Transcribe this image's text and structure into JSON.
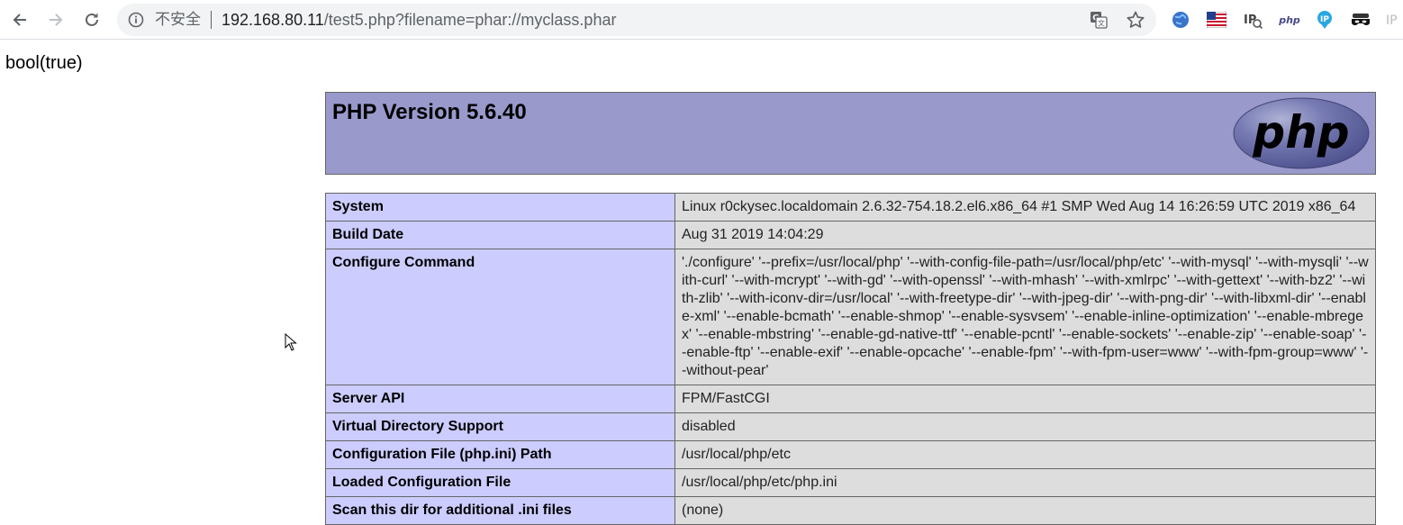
{
  "browser": {
    "security_label": "不安全",
    "url_host": "192.168.80.11",
    "url_path": "/test5.php?filename=phar://myclass.phar",
    "extensions": [
      "globe-icon",
      "flag-icon",
      "ip-icon",
      "php-icon",
      "ip-pin-icon",
      "mask-icon",
      "ip-icon"
    ],
    "ext_php_label": "php",
    "ext_ip_label": "IP",
    "ext_ip_label_2": "IP"
  },
  "page": {
    "output": "bool(true)"
  },
  "phpinfo": {
    "title": "PHP Version 5.6.40",
    "logo_text": "php",
    "rows": [
      {
        "label": "System",
        "value": "Linux r0ckysec.localdomain 2.6.32-754.18.2.el6.x86_64 #1 SMP Wed Aug 14 16:26:59 UTC 2019 x86_64"
      },
      {
        "label": "Build Date",
        "value": "Aug 31 2019 14:04:29"
      },
      {
        "label": "Configure Command",
        "value": "'./configure' '--prefix=/usr/local/php' '--with-config-file-path=/usr/local/php/etc' '--with-mysql' '--with-mysqli' '--with-curl' '--with-mcrypt' '--with-gd' '--with-openssl' '--with-mhash' '--with-xmlrpc' '--with-gettext' '--with-bz2' '--with-zlib' '--with-iconv-dir=/usr/local' '--with-freetype-dir' '--with-jpeg-dir' '--with-png-dir' '--with-libxml-dir' '--enable-xml' '--enable-bcmath' '--enable-shmop' '--enable-sysvsem' '--enable-inline-optimization' '--enable-mbregex' '--enable-mbstring' '--enable-gd-native-ttf' '--enable-pcntl' '--enable-sockets' '--enable-zip' '--enable-soap' '--enable-ftp' '--enable-exif' '--enable-opcache' '--enable-fpm' '--with-fpm-user=www' '--with-fpm-group=www' '--without-pear'"
      },
      {
        "label": "Server API",
        "value": "FPM/FastCGI"
      },
      {
        "label": "Virtual Directory Support",
        "value": "disabled"
      },
      {
        "label": "Configuration File (php.ini) Path",
        "value": "/usr/local/php/etc"
      },
      {
        "label": "Loaded Configuration File",
        "value": "/usr/local/php/etc/php.ini"
      },
      {
        "label": "Scan this dir for additional .ini files",
        "value": "(none)"
      }
    ]
  },
  "colors": {
    "header_bg": "#9999cc",
    "label_bg": "#ccccff",
    "value_bg": "#dddddd",
    "border": "#666666"
  }
}
